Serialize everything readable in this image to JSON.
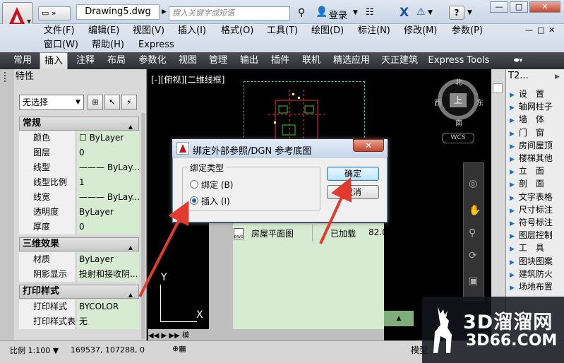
{
  "titlebar": {
    "doc_title": "Drawing5.dwg",
    "search_placeholder": "键入关键字或短语",
    "login": "登录",
    "win_min": "—",
    "win_max": "□",
    "win_close": "✕"
  },
  "menus": {
    "row1": [
      "文件(F)",
      "编辑(E)",
      "视图(V)",
      "插入(I)",
      "格式(O)",
      "工具(T)",
      "绘图(D)",
      "标注(N)",
      "修改(M)",
      "参数(P)"
    ],
    "row2": [
      "窗口(W)",
      "帮助(H)",
      "Express"
    ],
    "mdi": [
      "—",
      "□",
      "✕"
    ]
  },
  "ribbon_tabs": [
    "常用",
    "插入",
    "注释",
    "布局",
    "参数化",
    "视图",
    "管理",
    "输出",
    "插件",
    "联机",
    "精选应用",
    "天正建筑",
    "Express Tools"
  ],
  "ribbon_active": "插入",
  "properties": {
    "header": "特性",
    "selector": "无选择",
    "sections": [
      {
        "title": "常规",
        "rows": [
          {
            "k": "颜色",
            "v": "ByLayer"
          },
          {
            "k": "图层",
            "v": "0"
          },
          {
            "k": "线型",
            "v": "——— ByLay..."
          },
          {
            "k": "线型比例",
            "v": "1"
          },
          {
            "k": "线宽",
            "v": "——— ByLay..."
          },
          {
            "k": "透明度",
            "v": "ByLayer"
          },
          {
            "k": "厚度",
            "v": "0"
          }
        ]
      },
      {
        "title": "三维效果",
        "rows": [
          {
            "k": "材质",
            "v": "ByLayer"
          },
          {
            "k": "阴影显示",
            "v": "投射和接收阴..."
          }
        ]
      },
      {
        "title": "打印样式",
        "rows": [
          {
            "k": "打印样式",
            "v": "BYCOLOR"
          },
          {
            "k": "打印样式表",
            "v": "无"
          }
        ]
      }
    ]
  },
  "canvas": {
    "view_label": "[-][俯视][二维线框]",
    "compass": {
      "n": "北",
      "s": "南",
      "e": "东",
      "w": "西",
      "top": "上"
    },
    "wcs": "WCS",
    "ucs_x": "X",
    "ucs_y": "Y"
  },
  "xref": {
    "name": "房屋平面图",
    "status": "已加载",
    "size": "82.0"
  },
  "t2": {
    "title": "T2...",
    "items": [
      "设　置",
      "轴网柱子",
      "墙　体",
      "门　窗",
      "房间屋顶",
      "楼梯其他",
      "立　面",
      "剖　面",
      "文字表格",
      "尺寸标注",
      "符号标注",
      "图层控制",
      "工　具",
      "图块图案",
      "建筑防火",
      "场地布置"
    ]
  },
  "dialog": {
    "title": "绑定外部参照/DGN 参考底图",
    "group": "绑定类型",
    "opt_bind": "绑定 (B)",
    "opt_insert": "插入 (I)",
    "selected": "insert",
    "ok": "确定",
    "cancel": "取消",
    "close": "✕"
  },
  "statusbar": {
    "scale": "比例 1:100",
    "coords": "169537, 107288, 0",
    "model": "模型"
  },
  "tabbar": {
    "model_tab": "模"
  },
  "watermark": {
    "brand": "3D溜溜网",
    "url": "3D66.COM"
  },
  "colors": {
    "arrow": "#e23b2e",
    "grid_green": "#d7ebd2",
    "accent_blue": "#1e4fa6"
  }
}
